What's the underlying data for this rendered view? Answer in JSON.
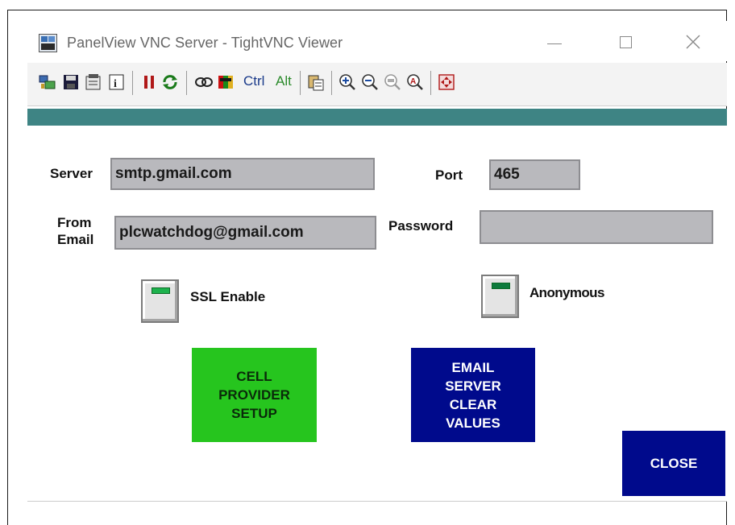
{
  "window": {
    "title": "PanelView VNC Server - TightVNC Viewer",
    "app_icon": "vnc-app-icon",
    "controls": [
      "minimize-icon",
      "maximize-icon",
      "close-icon"
    ]
  },
  "toolbar": {
    "ctrl_label": "Ctrl",
    "alt_label": "Alt",
    "icons": [
      "new-connection-icon",
      "save-icon",
      "options-icon",
      "info-icon",
      "pause-icon",
      "refresh-icon",
      "key-icon",
      "send-ctrl-alt-del-icon",
      "copy-clipboard-icon",
      "zoom-in-icon",
      "zoom-out-icon",
      "zoom-100-icon",
      "zoom-auto-icon",
      "fullscreen-icon"
    ]
  },
  "form": {
    "server_label": "Server",
    "server_value": "smtp.gmail.com",
    "port_label": "Port",
    "port_value": "465",
    "from_label_1": "From",
    "from_label_2": "Email",
    "from_value": "plcwatchdog@gmail.com",
    "password_label": "Password",
    "password_value": "",
    "ssl_label": "SSL Enable",
    "anon_label": "Anonymous"
  },
  "buttons": {
    "cell_1": "CELL",
    "cell_2": "PROVIDER",
    "cell_3": "SETUP",
    "clear_1": "EMAIL",
    "clear_2": "SERVER",
    "clear_3": "CLEAR",
    "clear_4": "VALUES",
    "close": "CLOSE"
  },
  "colors": {
    "teal_bar": "#3e8484",
    "field_bg": "#b9b9bd",
    "green_button": "#26c51e",
    "navy_button": "#000a8c",
    "led_green": "#1db24d"
  }
}
